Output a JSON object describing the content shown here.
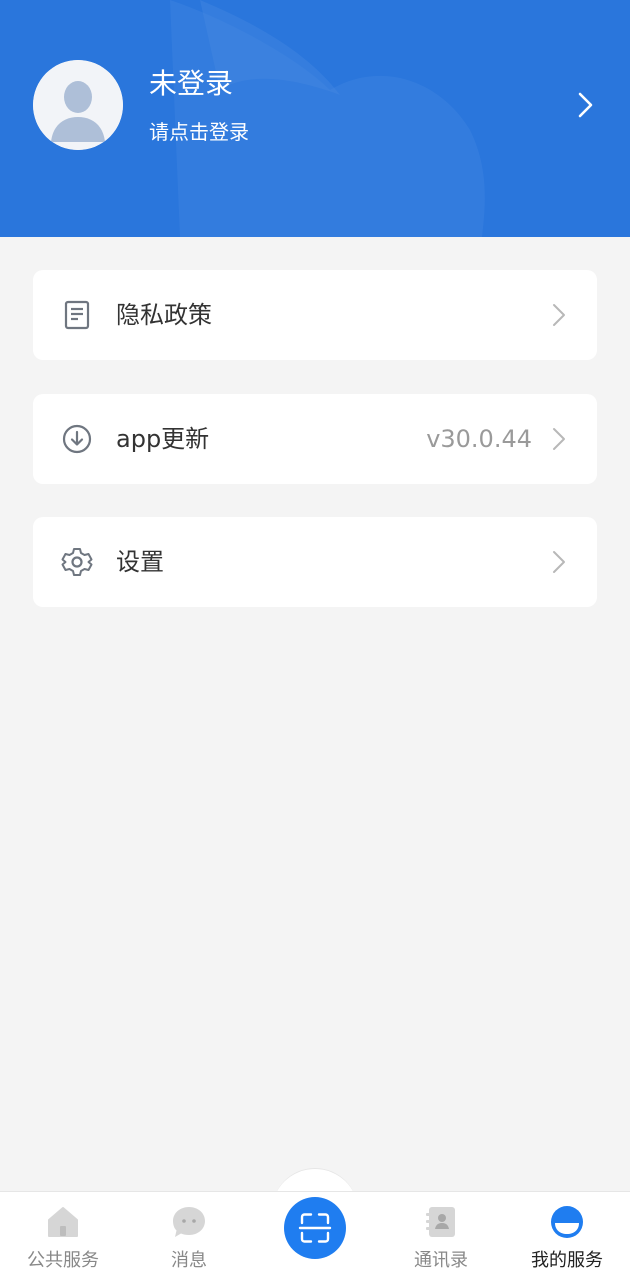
{
  "header": {
    "title": "未登录",
    "subtitle": "请点击登录",
    "bg_color": "#2a76dc"
  },
  "menu": [
    {
      "label": "隐私政策",
      "value": "",
      "icon": "document-icon"
    },
    {
      "label": "app更新",
      "value": "v30.0.44",
      "icon": "download-icon"
    },
    {
      "label": "设置",
      "value": "",
      "icon": "gear-icon"
    }
  ],
  "tabbar": {
    "tabs": [
      {
        "label": "公共服务",
        "icon": "home-icon",
        "active": false
      },
      {
        "label": "消息",
        "icon": "chat-icon",
        "active": false
      },
      {
        "label": "",
        "icon": "scan-icon",
        "active": false
      },
      {
        "label": "通讯录",
        "icon": "contacts-icon",
        "active": false
      },
      {
        "label": "我的服务",
        "icon": "profile-icon",
        "active": true
      }
    ],
    "accent_color": "#1f7df0"
  }
}
